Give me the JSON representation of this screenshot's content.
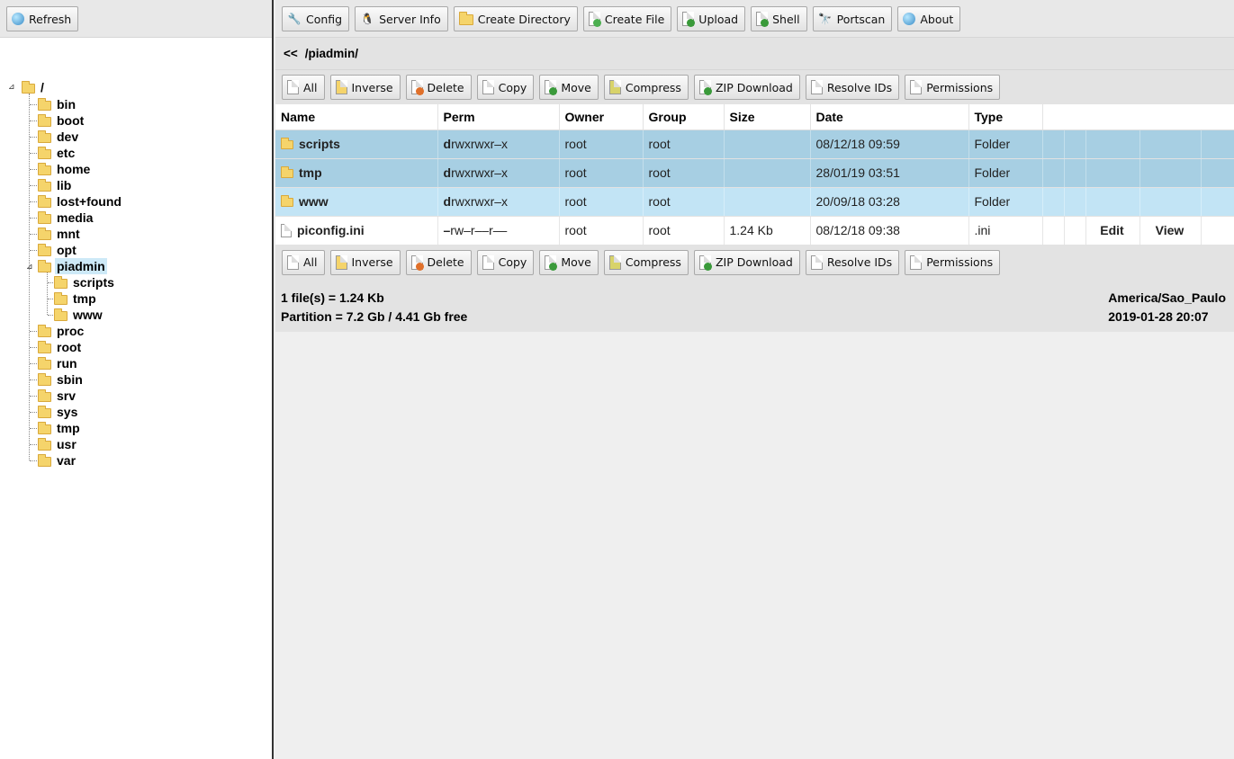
{
  "left": {
    "refresh_label": "Refresh"
  },
  "tree": {
    "root": "/",
    "items": [
      "bin",
      "boot",
      "dev",
      "etc",
      "home",
      "lib",
      "lost+found",
      "media",
      "mnt",
      "opt",
      "piadmin",
      "proc",
      "root",
      "run",
      "sbin",
      "srv",
      "sys",
      "tmp",
      "usr",
      "var"
    ],
    "piadmin_children": [
      "scripts",
      "tmp",
      "www"
    ]
  },
  "toolbar": {
    "config": "Config",
    "server_info": "Server Info",
    "create_directory": "Create Directory",
    "create_file": "Create File",
    "upload": "Upload",
    "shell": "Shell",
    "portscan": "Portscan",
    "about": "About"
  },
  "path": {
    "back": "<<",
    "current": "/piadmin/"
  },
  "actions": {
    "all": "All",
    "inverse": "Inverse",
    "delete": "Delete",
    "copy": "Copy",
    "move": "Move",
    "compress": "Compress",
    "zip_download": "ZIP Download",
    "resolve_ids": "Resolve IDs",
    "permissions": "Permissions"
  },
  "table": {
    "headers": [
      "Name",
      "Perm",
      "Owner",
      "Group",
      "Size",
      "Date",
      "Type"
    ],
    "rows": [
      {
        "name": "scripts",
        "perm_first": "d",
        "perm_rest": "rwxrwxr–x",
        "owner": "root",
        "group": "root",
        "size": "",
        "date": "08/12/18 09:59",
        "type": "Folder"
      },
      {
        "name": "tmp",
        "perm_first": "d",
        "perm_rest": "rwxrwxr–x",
        "owner": "root",
        "group": "root",
        "size": "",
        "date": "28/01/19 03:51",
        "type": "Folder"
      },
      {
        "name": "www",
        "perm_first": "d",
        "perm_rest": "rwxrwxr–x",
        "owner": "root",
        "group": "root",
        "size": "",
        "date": "20/09/18 03:28",
        "type": "Folder"
      },
      {
        "name": "piconfig.ini",
        "perm_first": "–",
        "perm_rest": "rw–r––r––",
        "owner": "root",
        "group": "root",
        "size": "1.24 Kb",
        "date": "08/12/18 09:38",
        "type": ".ini",
        "edit": "Edit",
        "view": "View"
      }
    ]
  },
  "status": {
    "files": "1 file(s) = 1.24 Kb",
    "partition": "Partition = 7.2 Gb / 4.41 Gb free",
    "timezone": "America/Sao_Paulo",
    "datetime": "2019-01-28 20:07"
  }
}
